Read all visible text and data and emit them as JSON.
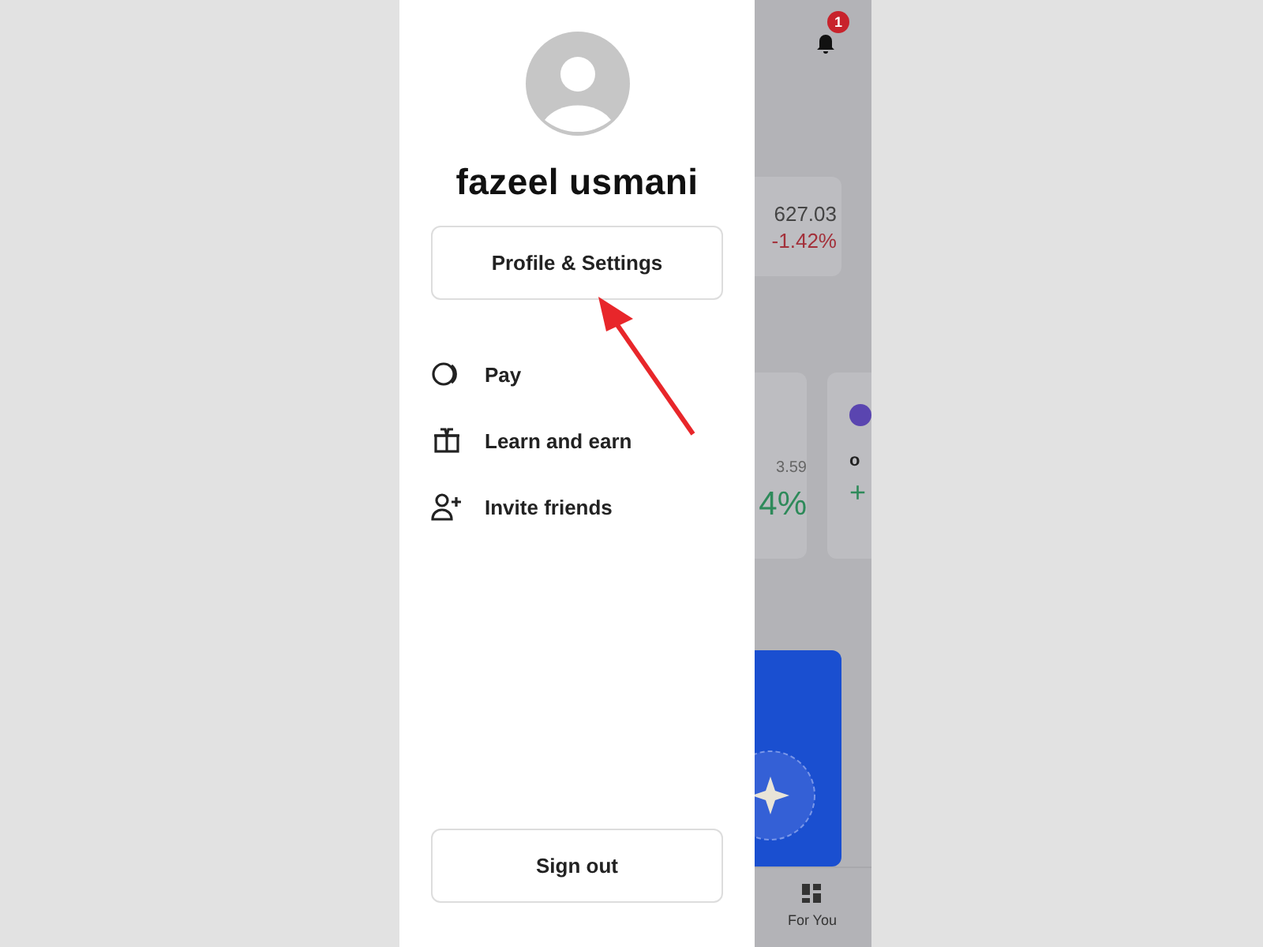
{
  "drawer": {
    "user_name": "fazeel usmani",
    "profile_button": "Profile & Settings",
    "menu_items": [
      {
        "label": "Pay"
      },
      {
        "label": "Learn and earn"
      },
      {
        "label": "Invite friends"
      }
    ],
    "sign_out": "Sign out"
  },
  "background_app": {
    "notification_count": "1",
    "price_card": {
      "price": "627.03",
      "change": "-1.42%"
    },
    "asset_cards": [
      {
        "price": "3.59",
        "change": "4%"
      },
      {
        "price": "o",
        "change": "+"
      }
    ],
    "bottom_nav": [
      {
        "label": "For You"
      }
    ]
  }
}
